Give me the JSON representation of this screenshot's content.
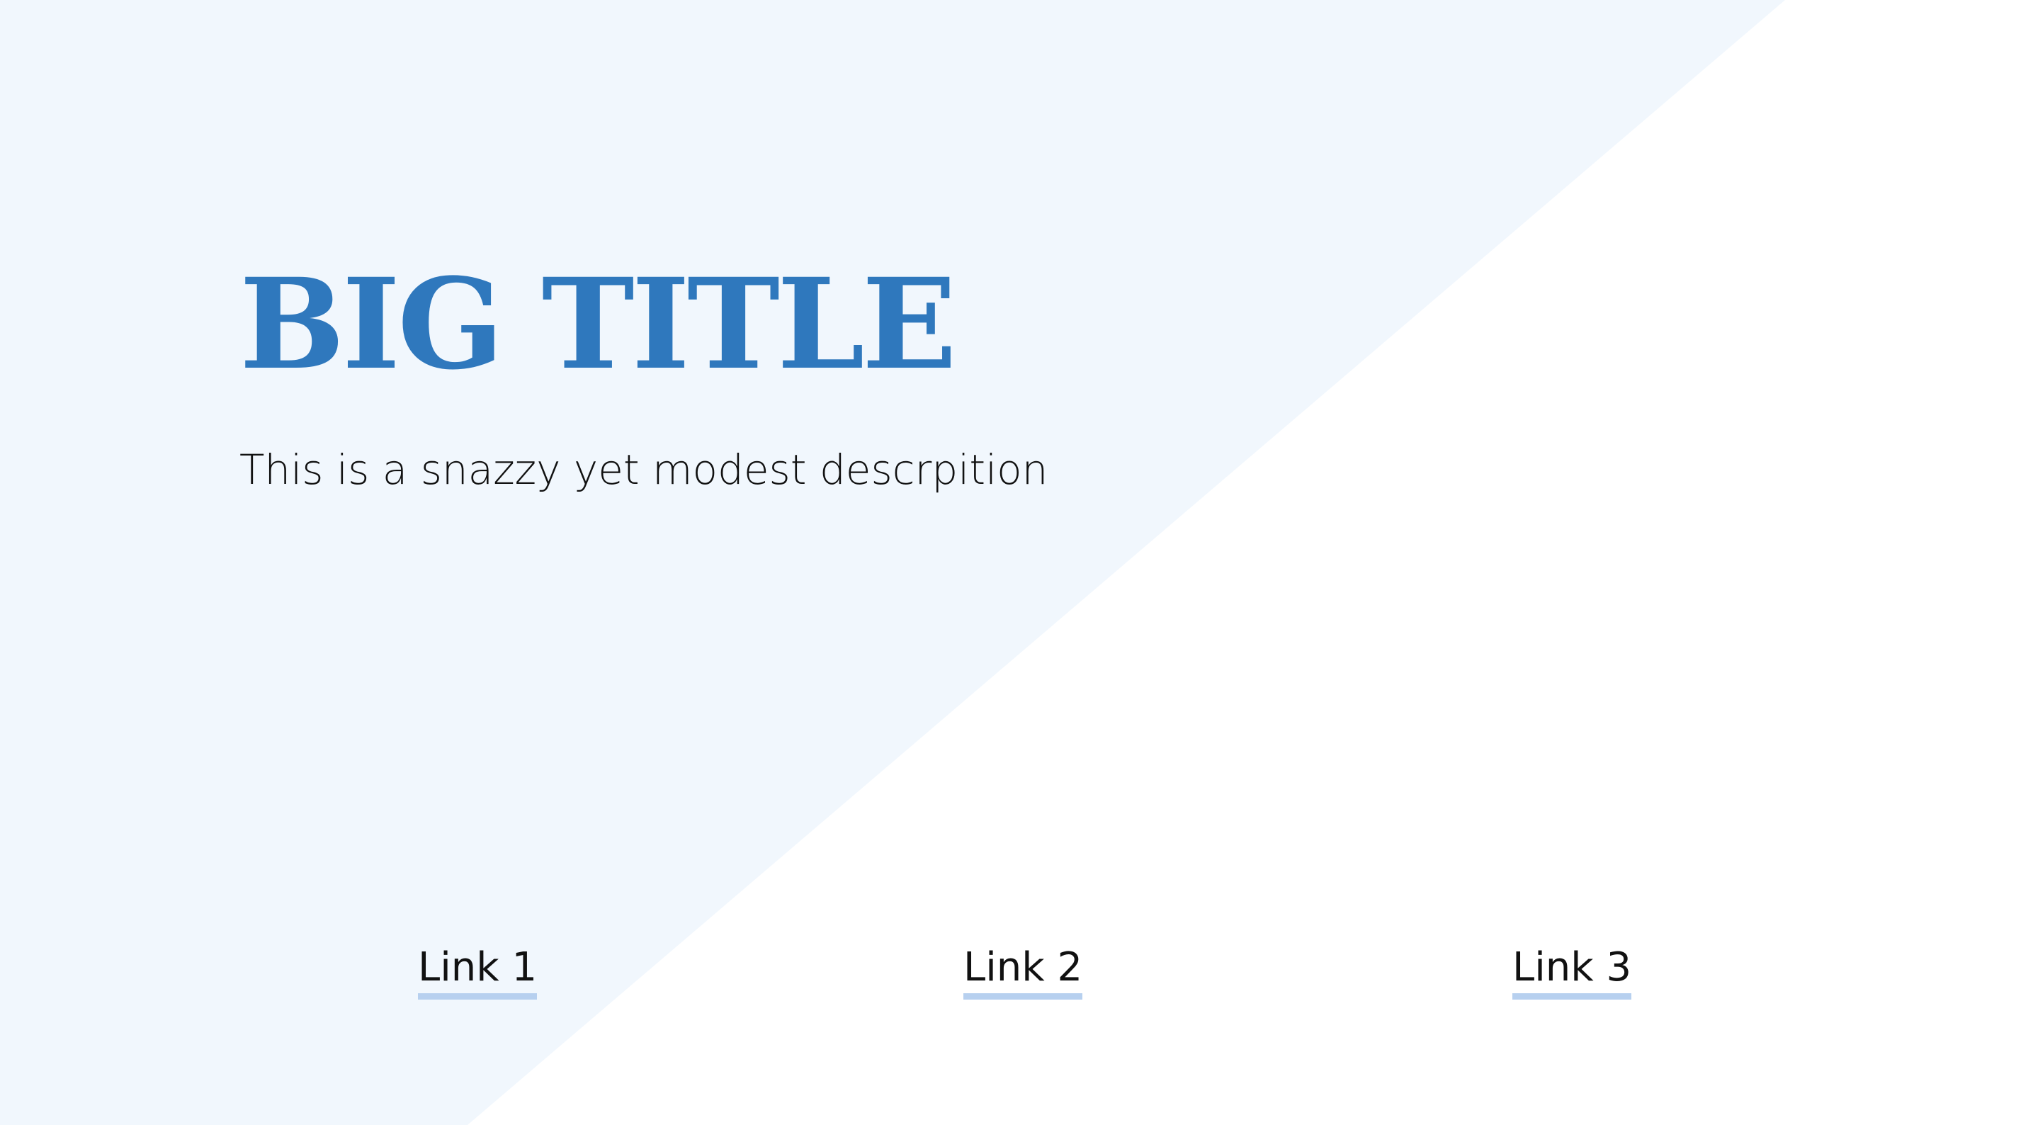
{
  "hero": {
    "title": "BIG TITLE",
    "description": "This is a snazzy yet modest descrpition"
  },
  "nav": {
    "links": [
      {
        "label": "Link 1"
      },
      {
        "label": "Link 2"
      },
      {
        "label": "Link 3"
      }
    ]
  },
  "colors": {
    "title": "#2f78bd",
    "background_triangle": "#f1f7fd",
    "link_underline": "#b7d0ef",
    "text": "#111111"
  }
}
